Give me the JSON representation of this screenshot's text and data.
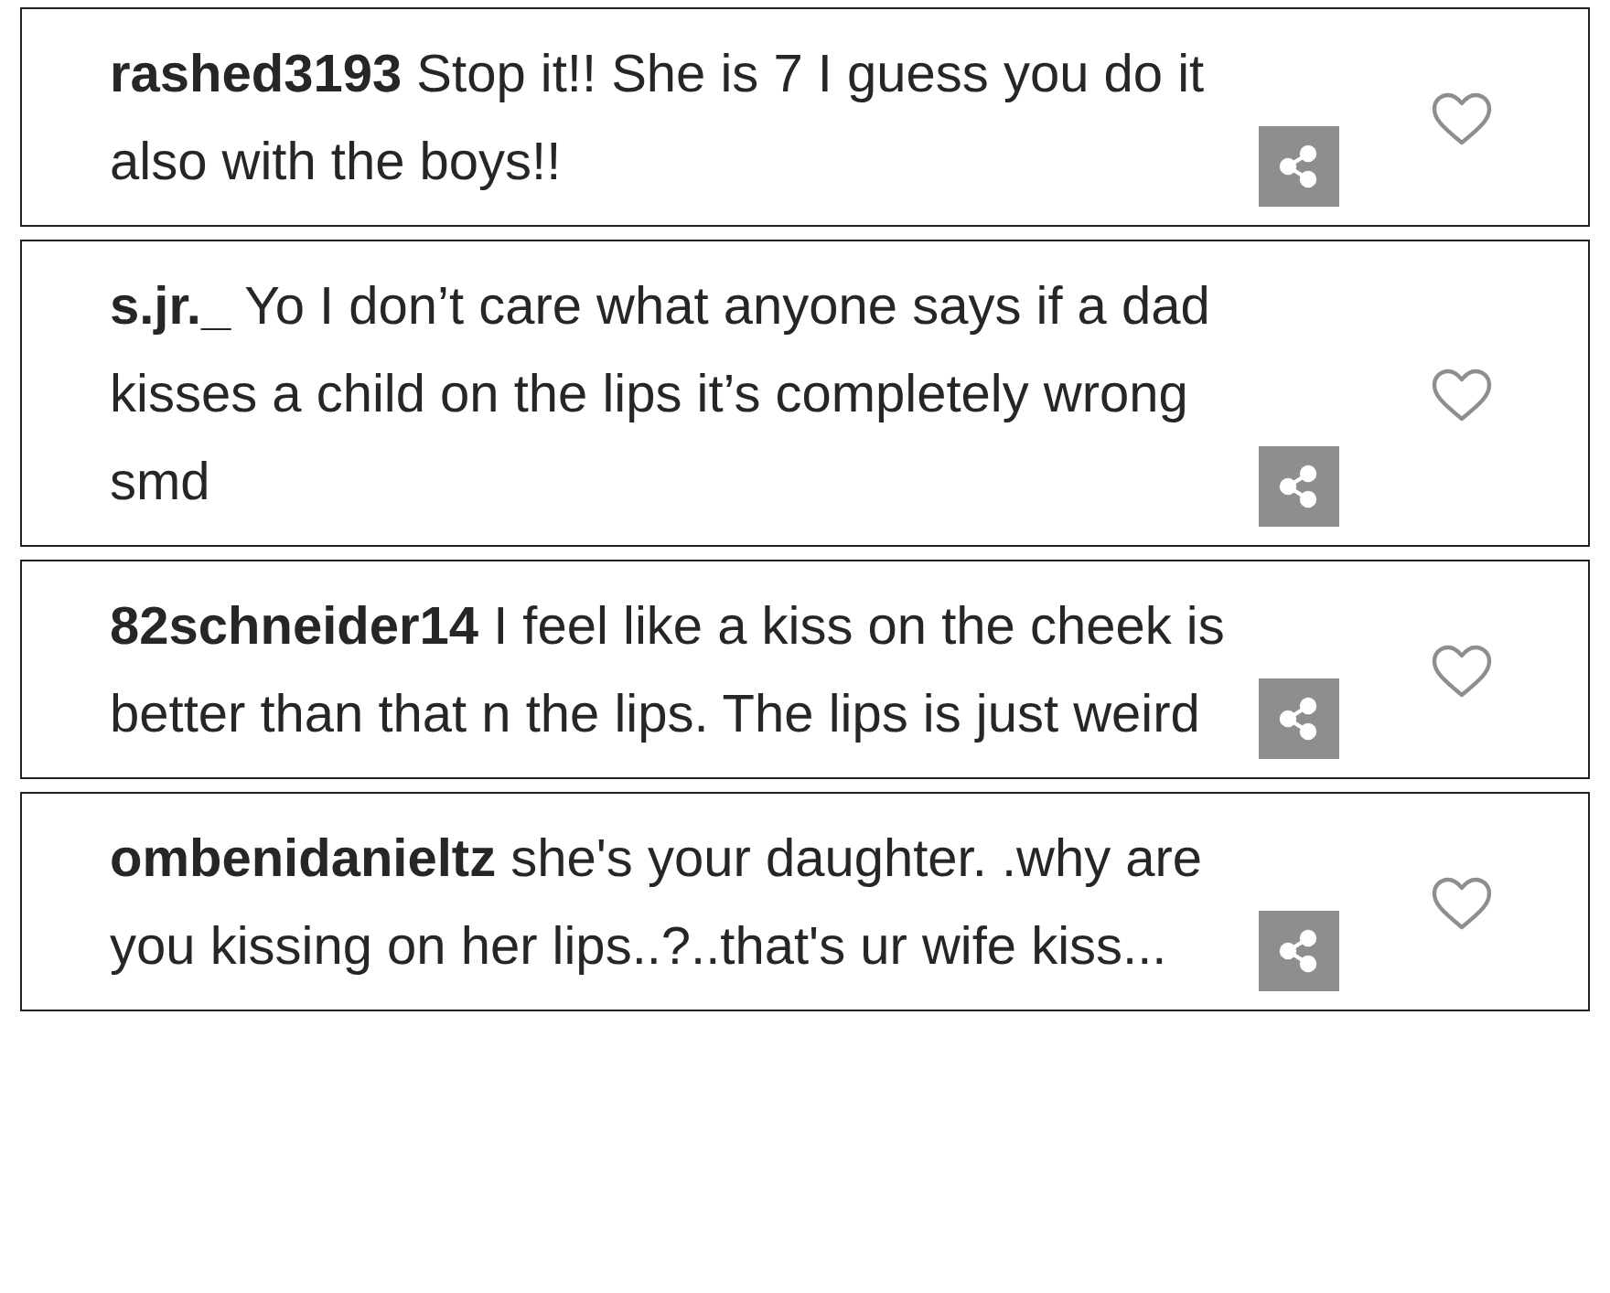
{
  "comments": [
    {
      "username": "rashed3193",
      "text": "Stop it!! She is 7 I guess you do it also with the boys!!",
      "liked": false
    },
    {
      "username": "s.jr._",
      "text": "Yo I don’t care what anyone says if a dad kisses a child on the lips it’s completely wrong smd",
      "liked": false
    },
    {
      "username": "82schneider14",
      "text": "I feel like a kiss on the cheek is better than that n the lips. The lips is just weird",
      "liked": false
    },
    {
      "username": "ombenidanieltz",
      "text": "she's your daughter. .why are you kissing on her lips..?..that's ur wife kiss...",
      "liked": false
    }
  ]
}
